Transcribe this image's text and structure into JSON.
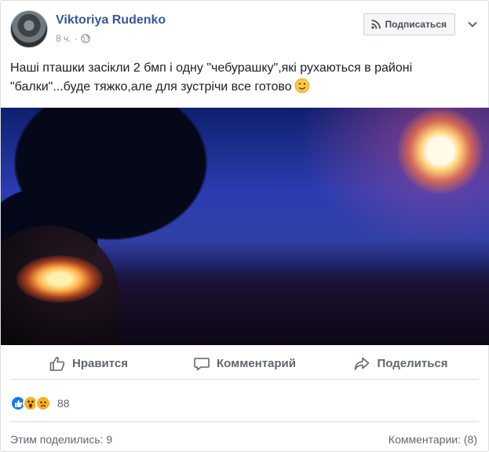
{
  "post": {
    "author": "Viktoriya Rudenko",
    "time": "8 ч.",
    "privacy_icon": "globe-icon",
    "follow_label": "Подписаться",
    "text": "Наші пташки засікли 2 бмп і одну \"чебурашку\",які рухаються в районі \"балки\"...буде тяжко,але для зустрічи все готово"
  },
  "actions": {
    "like": "Нравится",
    "comment": "Комментарий",
    "share": "Поделиться"
  },
  "reactions": {
    "count": "88",
    "types": [
      "like",
      "wow",
      "sad"
    ]
  },
  "footer": {
    "shares": "Этим поделились: 9",
    "comments": "Комментарии: (8)"
  },
  "colors": {
    "link": "#385898",
    "like_blue": "#1877f2",
    "muted": "#606770"
  }
}
